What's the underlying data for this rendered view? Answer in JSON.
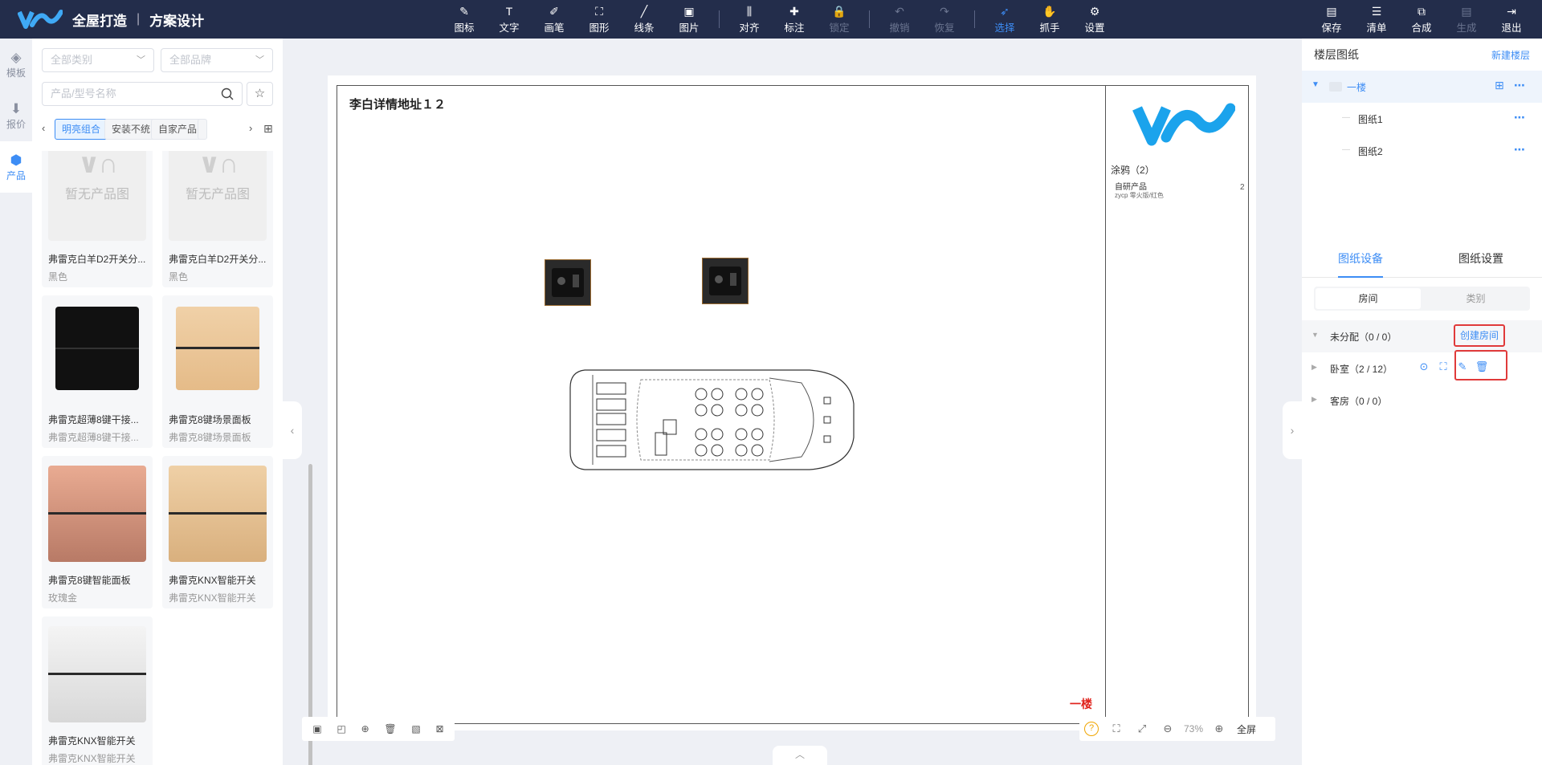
{
  "app": {
    "title": "全屋打造",
    "subtitle": "方案设计"
  },
  "toolbar": {
    "tools": [
      {
        "label": "图标",
        "icon": "✎"
      },
      {
        "label": "文字",
        "icon": "T"
      },
      {
        "label": "画笔",
        "icon": "✐"
      },
      {
        "label": "图形",
        "icon": "⛶"
      },
      {
        "label": "线条",
        "icon": "╱"
      },
      {
        "label": "图片",
        "icon": "▣"
      },
      {
        "label": "对齐",
        "icon": "⫼"
      },
      {
        "label": "标注",
        "icon": "✚"
      },
      {
        "label": "锁定",
        "icon": "🔒"
      },
      {
        "label": "撤销",
        "icon": "↶"
      },
      {
        "label": "恢复",
        "icon": "↷"
      },
      {
        "label": "选择",
        "icon": "➶"
      },
      {
        "label": "抓手",
        "icon": "✋"
      },
      {
        "label": "设置",
        "icon": "⚙"
      }
    ],
    "right": [
      {
        "label": "保存",
        "icon": "▤"
      },
      {
        "label": "清单",
        "icon": "☰"
      },
      {
        "label": "合成",
        "icon": "⧉"
      },
      {
        "label": "生成",
        "icon": "▤"
      },
      {
        "label": "退出",
        "icon": "⇥"
      }
    ]
  },
  "rail": [
    {
      "label": "模板",
      "icon": "◈"
    },
    {
      "label": "报价",
      "icon": "⬇"
    },
    {
      "label": "产品",
      "icon": "⬢"
    }
  ],
  "filters": {
    "category_placeholder": "全部类别",
    "brand_placeholder": "全部品牌",
    "search_placeholder": "产品/型号名称"
  },
  "chips": [
    "明亮组合",
    "安装不统",
    "自家产品"
  ],
  "no_image_text": "暂无产品图",
  "products": [
    {
      "name": "弗雷克白羊D2开关分...",
      "sub": "黑色",
      "img": "none"
    },
    {
      "name": "弗雷克白羊D2开关分...",
      "sub": "黑色",
      "img": "none"
    },
    {
      "name": "弗雷克超薄8键干接...",
      "sub": "弗雷克超薄8键干接...",
      "img": "black"
    },
    {
      "name": "弗雷克8键场景面板",
      "sub": "弗雷克8键场景面板",
      "img": "gold"
    },
    {
      "name": "弗雷克8键智能面板",
      "sub": "玫瑰金",
      "img": "rose"
    },
    {
      "name": "弗雷克KNX智能开关",
      "sub": "弗雷克KNX智能开关",
      "img": "gold2"
    },
    {
      "name": "弗雷克KNX智能开关",
      "sub": "弗雷克KNX智能开关",
      "img": "silver"
    }
  ],
  "canvas": {
    "address": "李白详情地址１２",
    "floor_label": "一楼",
    "legend_title": "涂鸦（2）",
    "legend_item": "自研产品",
    "legend_item_sub": "zycp 零火版/红色",
    "legend_count": "2",
    "zoom": "73%",
    "fullscreen": "全屏"
  },
  "right_panel": {
    "title": "楼层图纸",
    "new_floor": "新建楼层",
    "floor": "一楼",
    "sheets": [
      "图纸1",
      "图纸2"
    ],
    "tabs": [
      "图纸设备",
      "图纸设置"
    ],
    "segments": [
      "房间",
      "类别"
    ],
    "rooms": [
      {
        "name": "未分配（0 / 0）"
      },
      {
        "name": "卧室（2 / 12）"
      },
      {
        "name": "客房（0 / 0）"
      }
    ],
    "create_room": "创建房间"
  },
  "colors": {
    "topbar": "#232d4b",
    "accent": "#3d8df5",
    "highlight_red": "#e03a3a"
  }
}
